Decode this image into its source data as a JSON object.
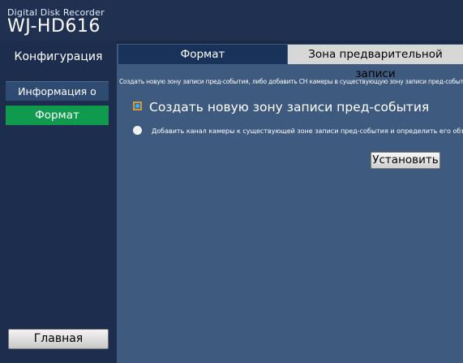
{
  "header": {
    "subtitle": "Digital Disk Recorder",
    "model": "WJ-HD616"
  },
  "sidebar": {
    "title": "Конфигурация",
    "items": [
      {
        "label": "Информация о диске"
      },
      {
        "label": "Формат"
      }
    ],
    "home_label": "Главная"
  },
  "tabs": [
    {
      "label": "Формат",
      "active": true
    },
    {
      "label": "Зона предварительной записи",
      "active": false
    }
  ],
  "content": {
    "description": "Создать новую зону записи пред-события, либо добавить CH камеры в существующую зону записи пред-события.",
    "options": [
      {
        "label": "Создать новую зону записи пред-события",
        "selected": true
      },
      {
        "label": "Добавить канал камеры к существующей зоне записи пред-события и определить его объем.",
        "selected": false
      }
    ],
    "set_button_label": "Установить"
  },
  "colors": {
    "background": "#1a2a44",
    "panel": "#3e5a7e",
    "active_green": "#0f9a4e",
    "tab_dark": "#19325a",
    "tab_light": "#d7d7d7"
  }
}
